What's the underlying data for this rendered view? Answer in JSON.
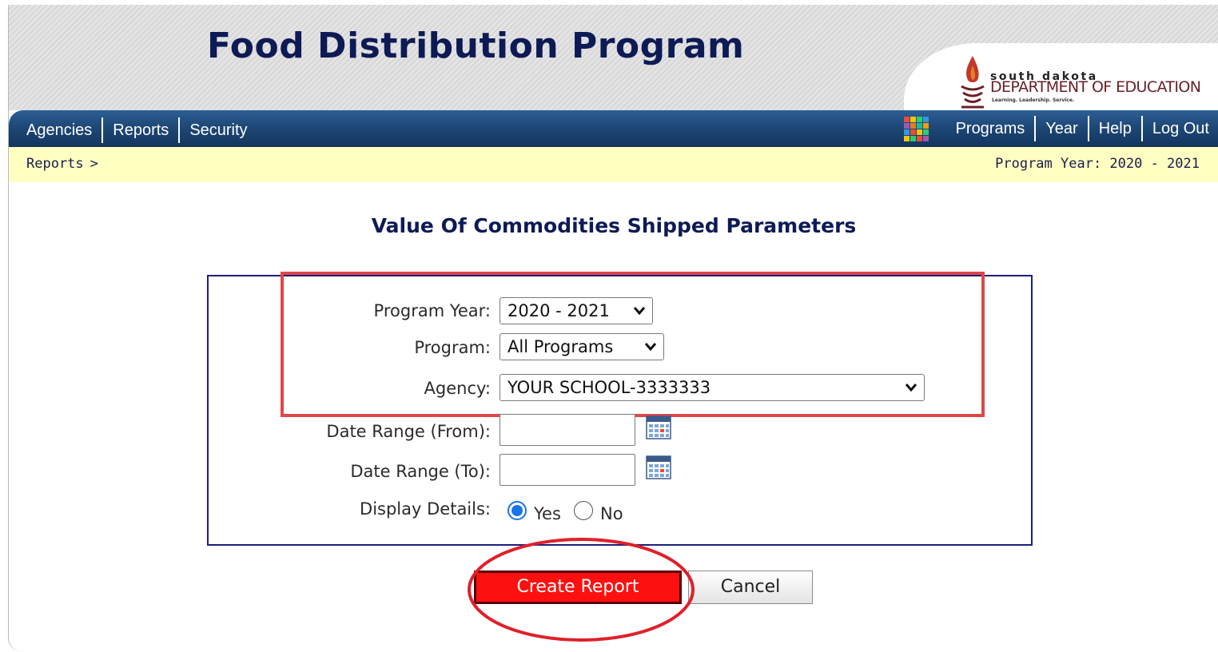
{
  "header": {
    "title": "Food Distribution Program",
    "logo": {
      "line1": "south dakota",
      "line2": "DEPARTMENT OF EDUCATION",
      "line3": "Learning. Leadership. Service."
    }
  },
  "nav": {
    "left": [
      {
        "label": "Agencies"
      },
      {
        "label": "Reports"
      },
      {
        "label": "Security"
      }
    ],
    "right": {
      "programs": "Programs",
      "year": "Year",
      "help": "Help",
      "logout": "Log Out"
    },
    "icon": "programs-grid-icon"
  },
  "breadcrumb": {
    "item": "Reports",
    "separator": ">",
    "program_year": "Program Year: 2020 - 2021"
  },
  "page": {
    "title": "Value Of Commodities Shipped Parameters"
  },
  "form": {
    "program_year": {
      "label": "Program Year:",
      "value": "2020 - 2021"
    },
    "program": {
      "label": "Program:",
      "value": "All Programs"
    },
    "agency": {
      "label": "Agency:",
      "value": "YOUR SCHOOL-3333333"
    },
    "date_from": {
      "label": "Date Range (From):",
      "value": ""
    },
    "date_to": {
      "label": "Date Range (To):",
      "value": ""
    },
    "display_details": {
      "label": "Display Details:",
      "options": [
        {
          "label": "Yes",
          "checked": true
        },
        {
          "label": "No",
          "checked": false
        }
      ]
    }
  },
  "buttons": {
    "create": "Create Report",
    "cancel": "Cancel"
  },
  "colors": {
    "title_navy": "#0d1a55",
    "nav_blue": "#1e4876",
    "breadcrumb_yellow": "#ffffc2",
    "create_red": "#ff1010",
    "annotation_red": "#e0474a"
  }
}
